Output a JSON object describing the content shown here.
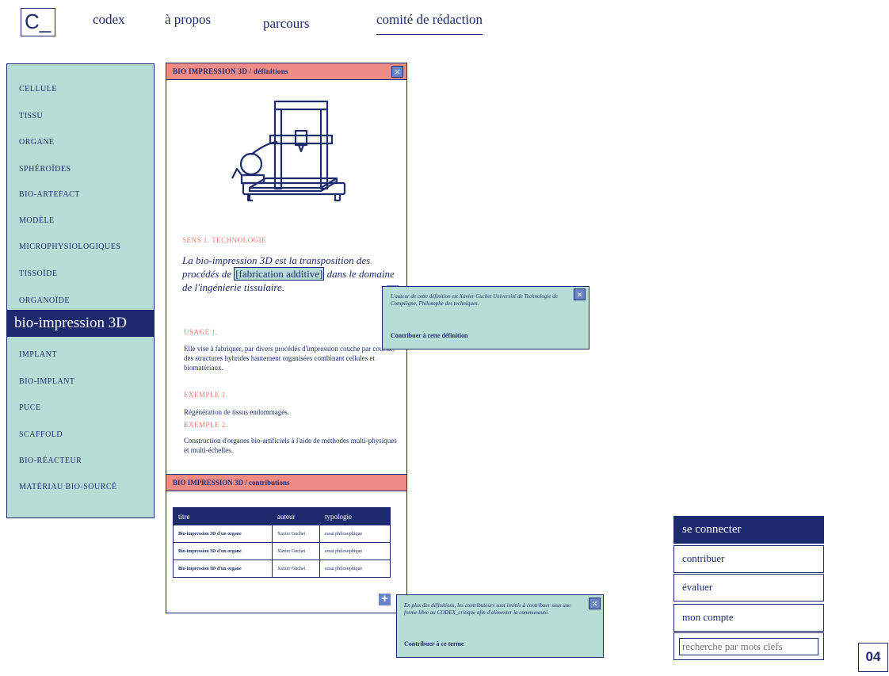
{
  "header": {
    "logo": "C_",
    "nav": [
      "codex",
      "à propos",
      "parcours",
      "comité de rédaction"
    ]
  },
  "sidebar": {
    "items": [
      "CELLULE",
      "TISSU",
      "ORGANE",
      "SPHÉROÏDES",
      "BIO-ARTEFACT",
      "MODÈLE",
      "MICROPHYSIOLOGIQUES",
      "TISSOÏDE",
      "ORGANOÏDE"
    ],
    "active": "bio-impression 3D",
    "items_after": [
      "IMPLANT",
      "BIO-IMPLANT",
      "PUCE",
      "SCAFFOLD",
      "BIO-RÉACTEUR",
      "MATÉRIAU BIO-SOURCÉ"
    ]
  },
  "definition_panel": {
    "title": "BIO IMPRESSION 3D / définitions",
    "close_icon": "close-icon",
    "illustration": "3d-printer-icon",
    "sense_label": "SENS 1. TECHNOLOGIE",
    "definition_before": "La bio-impression 3D est la transposition des procédés de ",
    "definition_highlight": "[fabrication additive]",
    "definition_after": " dans le domaine de l'ingénierie tissulaire.",
    "usage_label": "USAGE 1.",
    "usage_text": "Elle vise à fabriquer, par divers procédés d'impression couche par couche, des structures hybrides hautement organisées combinant cellules et biomatériaux.",
    "example1_label": "EXEMPLE 1.",
    "example1_text": "Régénération de tissus endommagés.",
    "example2_label": "EXEMPLE 2.",
    "example2_text": "Construction d'organes bio-artificiels à l'aide de méthodes multi-physiques et multi-échelles."
  },
  "author_popup": {
    "text": "L'auteur de cette définition est Xavier Guchet Université de Technologie de Compiègne, Philosophe des techniques.",
    "link": "Contribuer à cette définition"
  },
  "contributions_panel": {
    "title": "BIO IMPRESSION 3D / contributions",
    "columns": [
      "titre",
      "auteur",
      "typologie"
    ],
    "rows": [
      [
        "Bio-impression 3D d'un organe",
        "Xavier Guchet",
        "essai philosophique"
      ],
      [
        "Bio-impression 3D d'un organe",
        "Xavier Guchet",
        "essai philosophique"
      ],
      [
        "Bio-impression 3D d'un organe",
        "Xavier Guchet",
        "essai philosophique"
      ]
    ]
  },
  "contrib_popup": {
    "text": "En plus des définitions, les contributeurs sont invités à contribuer sous une forme libre au CODEX_critique afin d'alimenter la communauté.",
    "link": "Contribuer à ce terme"
  },
  "user_menu": {
    "items": [
      "se connecter",
      "contribuer",
      "évaluer",
      "mon compte"
    ],
    "search_placeholder": "recherche par mots clefs"
  },
  "page_number": "04",
  "colors": {
    "navy": "#1e2a6e",
    "mint": "#b6ddd6",
    "salmon": "#ef8b85",
    "blue_button": "#6b86c7"
  }
}
